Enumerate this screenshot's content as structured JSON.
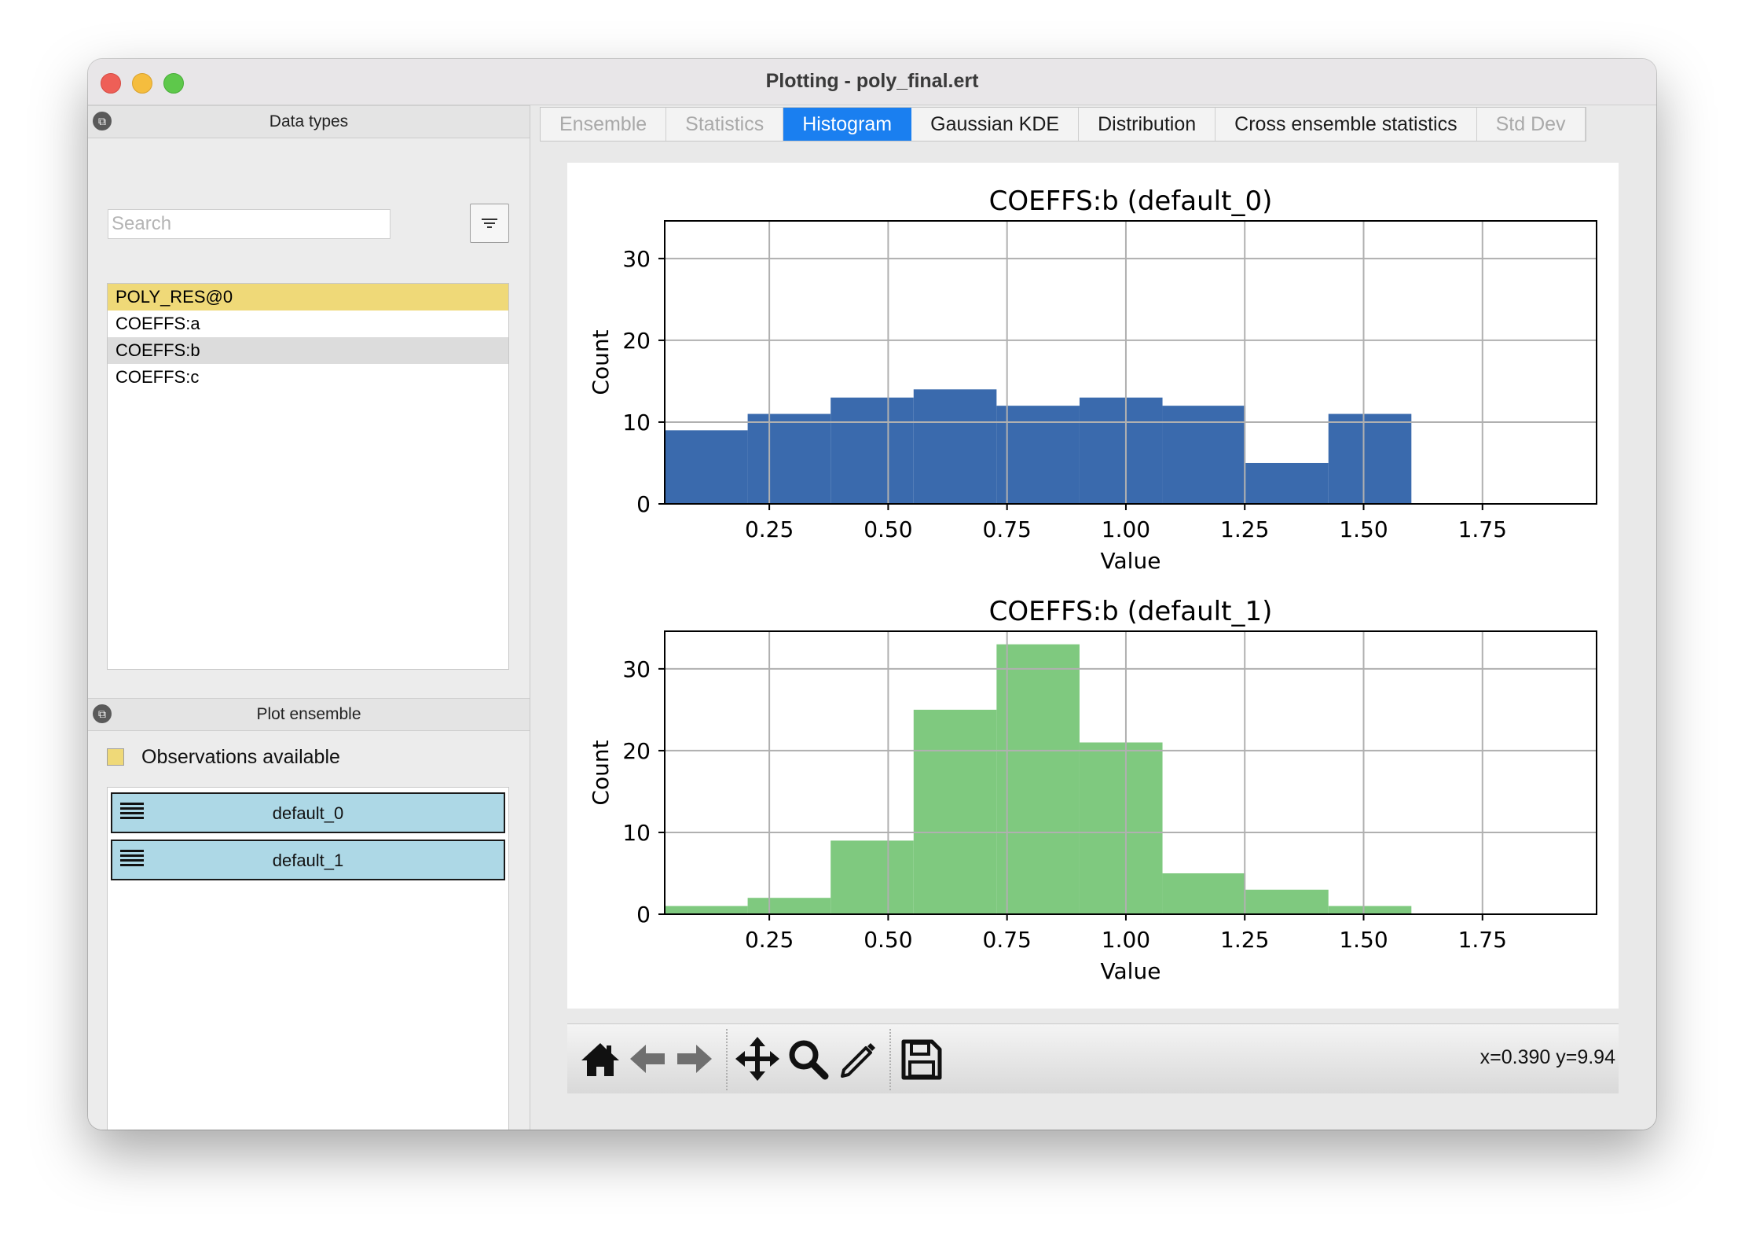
{
  "window": {
    "title": "Plotting - poly_final.ert"
  },
  "data_types": {
    "title": "Data types",
    "search_placeholder": "Search",
    "items": [
      {
        "label": "POLY_RES@0",
        "state": "observed"
      },
      {
        "label": "COEFFS:a",
        "state": "normal"
      },
      {
        "label": "COEFFS:b",
        "state": "selected"
      },
      {
        "label": "COEFFS:c",
        "state": "normal"
      }
    ],
    "legend": "Observations available",
    "observed_color": "#efd978"
  },
  "plot_ensemble": {
    "title": "Plot ensemble",
    "items": [
      "default_0",
      "default_1"
    ],
    "item_color": "#add8e6"
  },
  "tabs": [
    {
      "label": "Ensemble",
      "state": "disabled"
    },
    {
      "label": "Statistics",
      "state": "disabled"
    },
    {
      "label": "Histogram",
      "state": "active"
    },
    {
      "label": "Gaussian KDE",
      "state": "normal"
    },
    {
      "label": "Distribution",
      "state": "normal"
    },
    {
      "label": "Cross ensemble statistics",
      "state": "normal"
    },
    {
      "label": "Std Dev",
      "state": "disabled"
    }
  ],
  "toolbar": {
    "icons": [
      "home-icon",
      "back-arrow-icon",
      "forward-arrow-icon",
      "pan-move-icon",
      "zoom-magnifier-icon",
      "edit-pencil-icon",
      "save-disk-icon"
    ],
    "coords": "x=0.390 y=9.94"
  },
  "chart_data": [
    {
      "type": "bar",
      "title": "COEFFS:b (default_0)",
      "xlabel": "Value",
      "ylabel": "Count",
      "bin_edges": [
        0.03,
        0.2045,
        0.379,
        0.5535,
        0.728,
        0.9025,
        1.077,
        1.2515,
        1.426,
        1.6005,
        1.775
      ],
      "values": [
        9,
        11,
        13,
        14,
        12,
        13,
        12,
        5,
        11
      ],
      "color": "#3a6aad",
      "xlim": [
        0.03,
        1.99
      ],
      "ylim": [
        0,
        34.6
      ],
      "xticks": [
        "0.25",
        "0.50",
        "0.75",
        "1.00",
        "1.25",
        "1.50",
        "1.75"
      ],
      "yticks": [
        "0",
        "10",
        "20",
        "30"
      ],
      "grid": true
    },
    {
      "type": "bar",
      "title": "COEFFS:b (default_1)",
      "xlabel": "Value",
      "ylabel": "Count",
      "bin_edges": [
        0.03,
        0.2045,
        0.379,
        0.5535,
        0.728,
        0.9025,
        1.077,
        1.2515,
        1.426,
        1.6005,
        1.775
      ],
      "values": [
        1,
        2,
        9,
        25,
        33,
        21,
        5,
        3,
        1
      ],
      "color": "#7fc97f",
      "xlim": [
        0.03,
        1.99
      ],
      "ylim": [
        0,
        34.6
      ],
      "xticks": [
        "0.25",
        "0.50",
        "0.75",
        "1.00",
        "1.25",
        "1.50",
        "1.75"
      ],
      "yticks": [
        "0",
        "10",
        "20",
        "30"
      ],
      "grid": true
    }
  ]
}
